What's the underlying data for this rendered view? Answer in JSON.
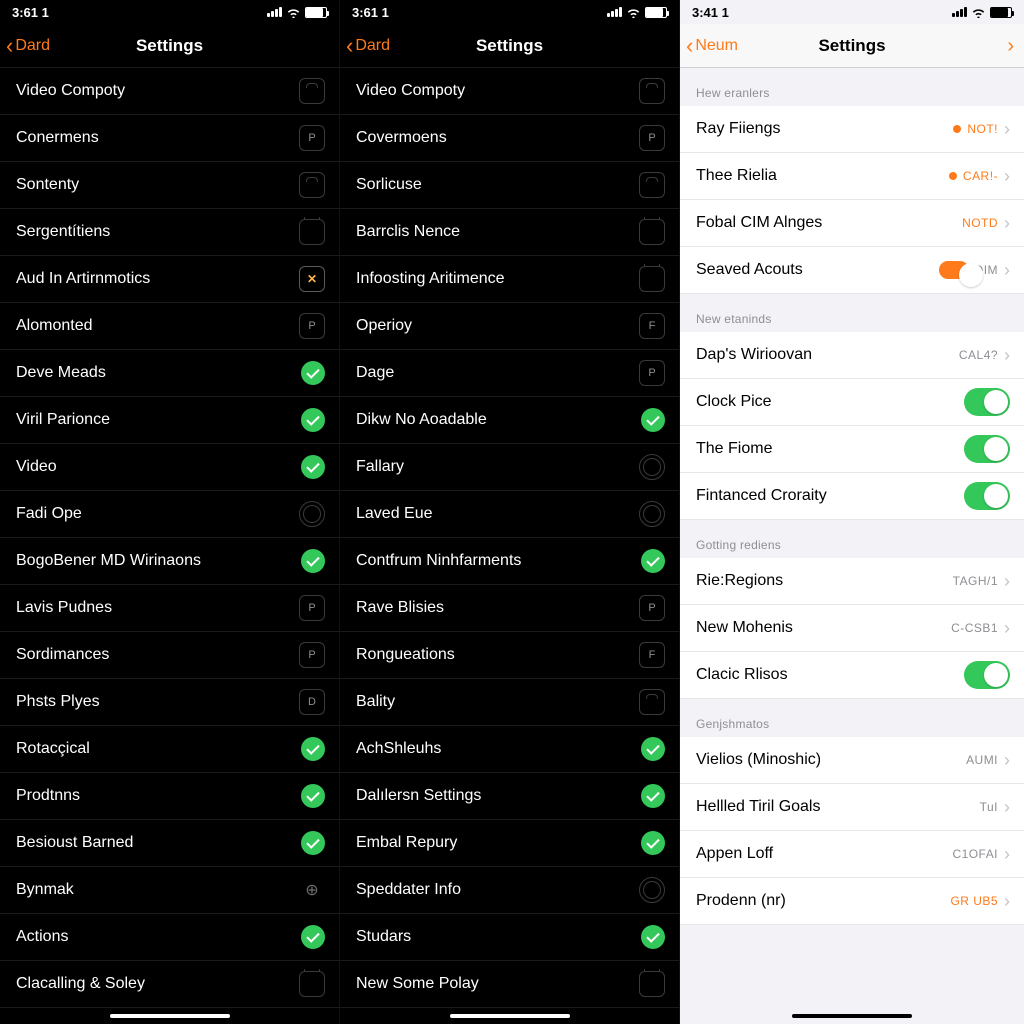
{
  "panes": [
    {
      "theme": "dark",
      "status_time": "3:61 1",
      "back_label": "Dard",
      "title": "Settings",
      "forward": false,
      "sections": [
        {
          "header": null,
          "rows": [
            {
              "label": "Video Compoty",
              "acc": "clip"
            },
            {
              "label": "Conermens",
              "acc": "p"
            },
            {
              "label": "Sontenty",
              "acc": "clip"
            },
            {
              "label": "Sergentítiens",
              "acc": "cal"
            },
            {
              "label": "Aud In Artirnmotics",
              "acc": "x"
            },
            {
              "label": "Alomonted",
              "acc": "p"
            },
            {
              "label": "Deve Meads",
              "acc": "check"
            },
            {
              "label": "Viril Parionce",
              "acc": "check"
            },
            {
              "label": "Video",
              "acc": "check"
            },
            {
              "label": "Fadi Ope",
              "acc": "globe"
            },
            {
              "label": "BogoBener MD Wirinaons",
              "acc": "check"
            },
            {
              "label": "Lavis Pudnes",
              "acc": "p"
            },
            {
              "label": "Sordimances",
              "acc": "p"
            },
            {
              "label": "Phsts Plyes",
              "acc": "d"
            },
            {
              "label": "Rotacçical",
              "acc": "check"
            },
            {
              "label": "Prodtnns",
              "acc": "check"
            },
            {
              "label": "Besioust Barned",
              "acc": "check"
            },
            {
              "label": "Bynmak",
              "acc": "drone"
            },
            {
              "label": "Actions",
              "acc": "check"
            },
            {
              "label": "Clacalling & Soley",
              "acc": "cal"
            }
          ]
        }
      ]
    },
    {
      "theme": "dark",
      "status_time": "3:61 1",
      "back_label": "Dard",
      "title": "Settings",
      "forward": false,
      "sections": [
        {
          "header": null,
          "rows": [
            {
              "label": "Video Compoty",
              "acc": "clip"
            },
            {
              "label": "Covermoens",
              "acc": "p"
            },
            {
              "label": "Sorlicuse",
              "acc": "clip"
            },
            {
              "label": "Barrclis Nence",
              "acc": "cal"
            },
            {
              "label": "Infoosting Aritimence",
              "acc": "cal"
            },
            {
              "label": "Operioy",
              "acc": "f"
            },
            {
              "label": "Dage",
              "acc": "p"
            },
            {
              "label": "Dikw No Aoadable",
              "acc": "check"
            },
            {
              "label": "Fallary",
              "acc": "globe"
            },
            {
              "label": "Laved Eue",
              "acc": "globe"
            },
            {
              "label": "Contfrum Ninhfarments",
              "acc": "check"
            },
            {
              "label": "Rave Blisies",
              "acc": "p"
            },
            {
              "label": "Rongueations",
              "acc": "f"
            },
            {
              "label": "Bality",
              "acc": "clip"
            },
            {
              "label": "AchShleuhs",
              "acc": "check"
            },
            {
              "label": "Dalılersn Settings",
              "acc": "check"
            },
            {
              "label": "Embal Repury",
              "acc": "check"
            },
            {
              "label": "Speddater Info",
              "acc": "globe"
            },
            {
              "label": "Studars",
              "acc": "check"
            },
            {
              "label": "New Some Polay",
              "acc": "cal"
            }
          ]
        }
      ]
    },
    {
      "theme": "light",
      "status_time": "3:41 1",
      "back_label": "Neum",
      "title": "Settings",
      "forward": true,
      "sections": [
        {
          "header": "Hew eranlers",
          "rows": [
            {
              "label": "Ray Fiiengs",
              "acc": "disclose",
              "value": "NOT!",
              "dot": true,
              "value_color": "orange"
            },
            {
              "label": "Thee Rielia",
              "acc": "disclose",
              "value": "CAR!-",
              "dot": true,
              "value_color": "orange"
            },
            {
              "label": "Fobal CIM Alnges",
              "acc": "disclose",
              "value": "NOTD",
              "value_color": "orange"
            },
            {
              "label": "Seaved Acouts",
              "acc": "disclose",
              "value": "DIM",
              "toggle_orange": true
            }
          ]
        },
        {
          "header": "New etaninds",
          "rows": [
            {
              "label": "Dap's Wirioovan",
              "acc": "disclose",
              "value": "CAL4?"
            },
            {
              "label": "Clock Pice",
              "acc": "toggle",
              "on": true
            },
            {
              "label": "The Fiome",
              "acc": "toggle",
              "on": true
            },
            {
              "label": "Fintanced Croraity",
              "acc": "toggle",
              "on": true
            }
          ]
        },
        {
          "header": "Gotting rediens",
          "rows": [
            {
              "label": "Rie:Regions",
              "acc": "disclose",
              "value": "TAGH/1"
            },
            {
              "label": "New Mohenis",
              "acc": "disclose",
              "value": "C-CSB1"
            },
            {
              "label": "Clacic Rlisos",
              "acc": "toggle",
              "on": true
            }
          ]
        },
        {
          "header": "Genjshmatos",
          "rows": [
            {
              "label": "Vielios (Minoshic)",
              "acc": "disclose",
              "value": "AUMI"
            },
            {
              "label": "Hellled Tiril Goals",
              "acc": "disclose",
              "value": "TuI"
            },
            {
              "label": "Appen Loff",
              "acc": "disclose",
              "value": "C1OFAI"
            },
            {
              "label": "Prodenn (nr)",
              "acc": "disclose",
              "value": "GR UB5",
              "value_color": "orange"
            }
          ]
        }
      ]
    }
  ]
}
